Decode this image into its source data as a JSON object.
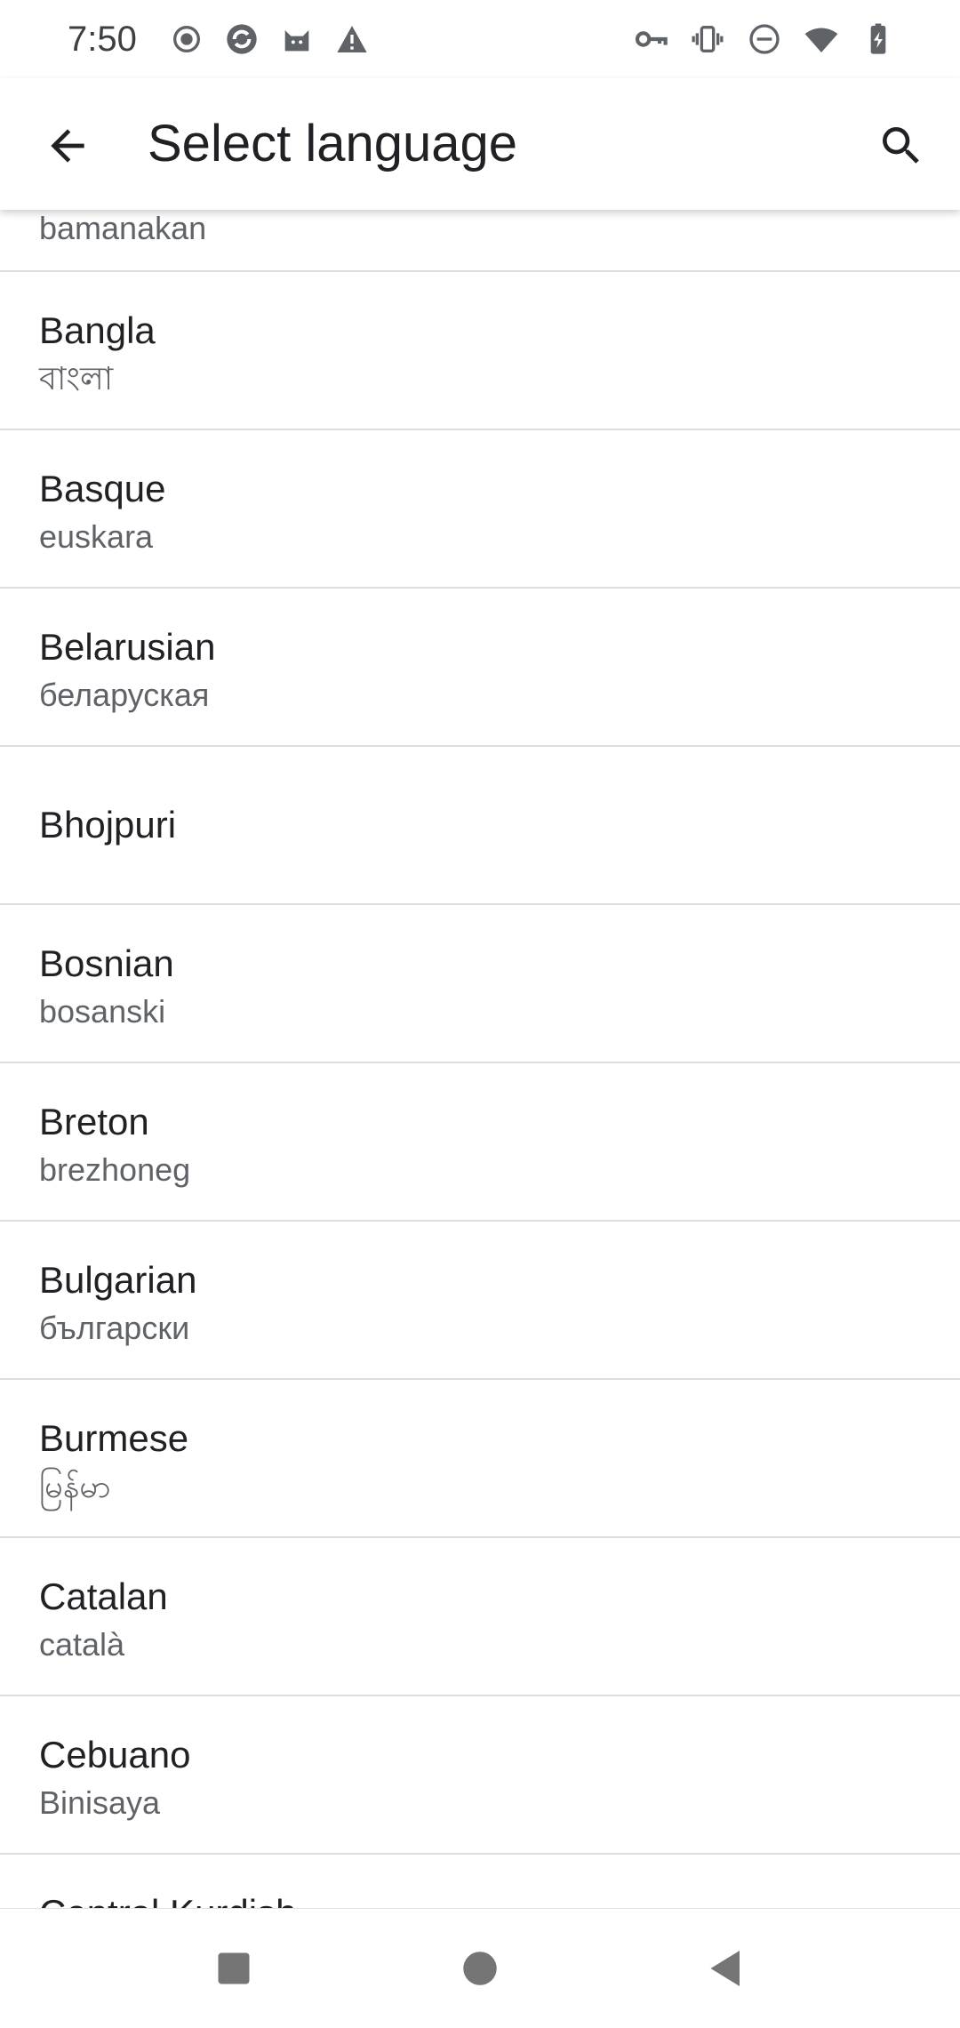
{
  "status_bar": {
    "time": "7:50",
    "left_icons": [
      "record-icon",
      "app-icon",
      "cat-icon",
      "warning-icon"
    ],
    "right_icons": [
      "vpn-key-icon",
      "vibrate-icon",
      "dnd-icon",
      "wifi-icon",
      "battery-charging-icon"
    ]
  },
  "app_bar": {
    "title": "Select language",
    "back_icon": "arrow-back-icon",
    "search_icon": "search-icon"
  },
  "languages": [
    {
      "name": "",
      "native": "bamanakan"
    },
    {
      "name": "Bangla",
      "native": "বাংলা"
    },
    {
      "name": "Basque",
      "native": "euskara"
    },
    {
      "name": "Belarusian",
      "native": "беларуская"
    },
    {
      "name": "Bhojpuri",
      "native": ""
    },
    {
      "name": "Bosnian",
      "native": "bosanski"
    },
    {
      "name": "Breton",
      "native": "brezhoneg"
    },
    {
      "name": "Bulgarian",
      "native": "български"
    },
    {
      "name": "Burmese",
      "native": "မြန်မာ"
    },
    {
      "name": "Catalan",
      "native": "català"
    },
    {
      "name": "Cebuano",
      "native": "Binisaya"
    },
    {
      "name": "Central Kurdish",
      "native": ""
    }
  ],
  "nav_bar": {
    "icons": [
      "recents-square-icon",
      "home-circle-icon",
      "back-triangle-icon"
    ]
  }
}
